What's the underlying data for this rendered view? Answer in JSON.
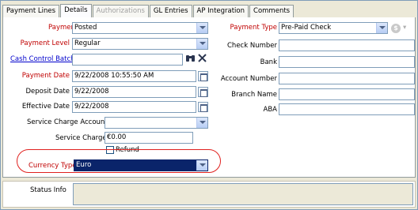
{
  "tabs": [
    {
      "label": "Payment Lines"
    },
    {
      "label": "Details"
    },
    {
      "label": "Authorizations"
    },
    {
      "label": "GL Entries"
    },
    {
      "label": "AP Integration"
    },
    {
      "label": "Comments"
    }
  ],
  "left": {
    "payment_status": {
      "label": "Payment Status",
      "value": "Posted"
    },
    "payment_level": {
      "label": "Payment Level",
      "value": "Regular"
    },
    "cash_control_batch": {
      "label": "Cash Control Batch",
      "value": ""
    },
    "payment_date": {
      "label": "Payment Date",
      "value": "9/22/2008 10:55:50 AM"
    },
    "deposit_date": {
      "label": "Deposit Date",
      "value": "9/22/2008"
    },
    "effective_date": {
      "label": "Effective Date",
      "value": "9/22/2008"
    },
    "service_charge_account": {
      "label": "Service Charge Account",
      "value": ""
    },
    "service_charge": {
      "label": "Service Charge",
      "value": "€0.00"
    },
    "refund": {
      "label": "Refund",
      "checked": false
    },
    "currency_type": {
      "label": "Currency Type",
      "value": "Euro"
    }
  },
  "right": {
    "payment_type": {
      "label": "Payment Type",
      "value": "Pre-Paid Check"
    },
    "check_number": {
      "label": "Check Number",
      "value": ""
    },
    "bank": {
      "label": "Bank",
      "value": ""
    },
    "account_number": {
      "label": "Account Number",
      "value": ""
    },
    "branch_name": {
      "label": "Branch Name",
      "value": ""
    },
    "aba": {
      "label": "ABA",
      "value": ""
    }
  },
  "status": {
    "label": "Status Info",
    "value": ""
  },
  "icons": {
    "binoculars": "binoculars-icon",
    "clear": "clear-icon",
    "dollar": "currency-icon",
    "calendar": "calendar-icon"
  },
  "colors": {
    "required_label": "#c00000",
    "link": "#0000cc",
    "highlight_ring": "#e0201e",
    "selected_field": "#0a246a"
  }
}
